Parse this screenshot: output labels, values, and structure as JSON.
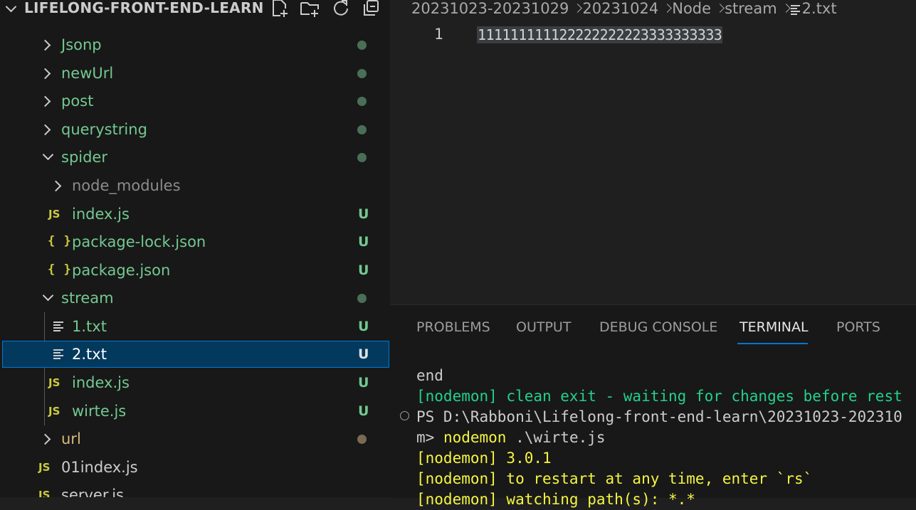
{
  "explorer": {
    "title": "LIFELONG-FRONT-END-LEARN",
    "actions": [
      "new-file-icon",
      "new-folder-icon",
      "refresh-icon",
      "collapse-all-icon"
    ],
    "rows": [
      {
        "name": "Jsonp",
        "type": "folder",
        "expanded": false,
        "status": "dot-green"
      },
      {
        "name": "newUrl",
        "type": "folder",
        "expanded": false,
        "status": "dot-green"
      },
      {
        "name": "post",
        "type": "folder",
        "expanded": false,
        "status": "dot-green"
      },
      {
        "name": "querystring",
        "type": "folder",
        "expanded": false,
        "status": "dot-green"
      },
      {
        "name": "spider",
        "type": "folder",
        "expanded": true,
        "status": "dot-green"
      },
      {
        "name": "node_modules",
        "type": "folder",
        "expanded": false,
        "status": ""
      },
      {
        "name": "index.js",
        "type": "js",
        "status": "U"
      },
      {
        "name": "package-lock.json",
        "type": "json",
        "status": "U"
      },
      {
        "name": "package.json",
        "type": "json",
        "status": "U"
      },
      {
        "name": "stream",
        "type": "folder",
        "expanded": true,
        "status": "dot-green"
      },
      {
        "name": "1.txt",
        "type": "txt",
        "status": "U"
      },
      {
        "name": "2.txt",
        "type": "txt",
        "status": "U",
        "selected": true
      },
      {
        "name": "index.js",
        "type": "js",
        "status": "U"
      },
      {
        "name": "wirte.js",
        "type": "js",
        "status": "U"
      },
      {
        "name": "url",
        "type": "folder",
        "expanded": false,
        "status": "dot-brown"
      },
      {
        "name": "01index.js",
        "type": "js",
        "status": ""
      },
      {
        "name": "server.js",
        "type": "js",
        "status": ""
      }
    ],
    "icon_labels": {
      "js": "JS",
      "json": "{ }"
    }
  },
  "editor": {
    "breadcrumbs": [
      "20231023-20231029",
      "20231024",
      "Node",
      "stream",
      "2.txt"
    ],
    "line_number": "1",
    "line_content": "111111111122222222223333333333"
  },
  "panel": {
    "tabs": [
      "PROBLEMS",
      "OUTPUT",
      "DEBUG CONSOLE",
      "TERMINAL",
      "PORTS"
    ],
    "active_tab": "TERMINAL",
    "terminal": {
      "l1": "end",
      "l2": "[nodemon] clean exit - waiting for changes before rest",
      "l3": "PS D:\\Rabboni\\Lifelong-front-end-learn\\20231023-202310",
      "l4_prompt": "m> ",
      "l4_cmd": "nodemon",
      "l4_arg": " .\\wirte.js",
      "l5": "[nodemon] 3.0.1",
      "l6": "[nodemon] to restart at any time, enter `rs`",
      "l7": "[nodemon] watching path(s): *.*"
    }
  },
  "colors": {
    "untracked": "#73c991",
    "folder_untracked": "#73c991",
    "dim": "#8c8c8c",
    "dot_green": "#4b6e58",
    "dot_brown": "#7a6a52"
  }
}
